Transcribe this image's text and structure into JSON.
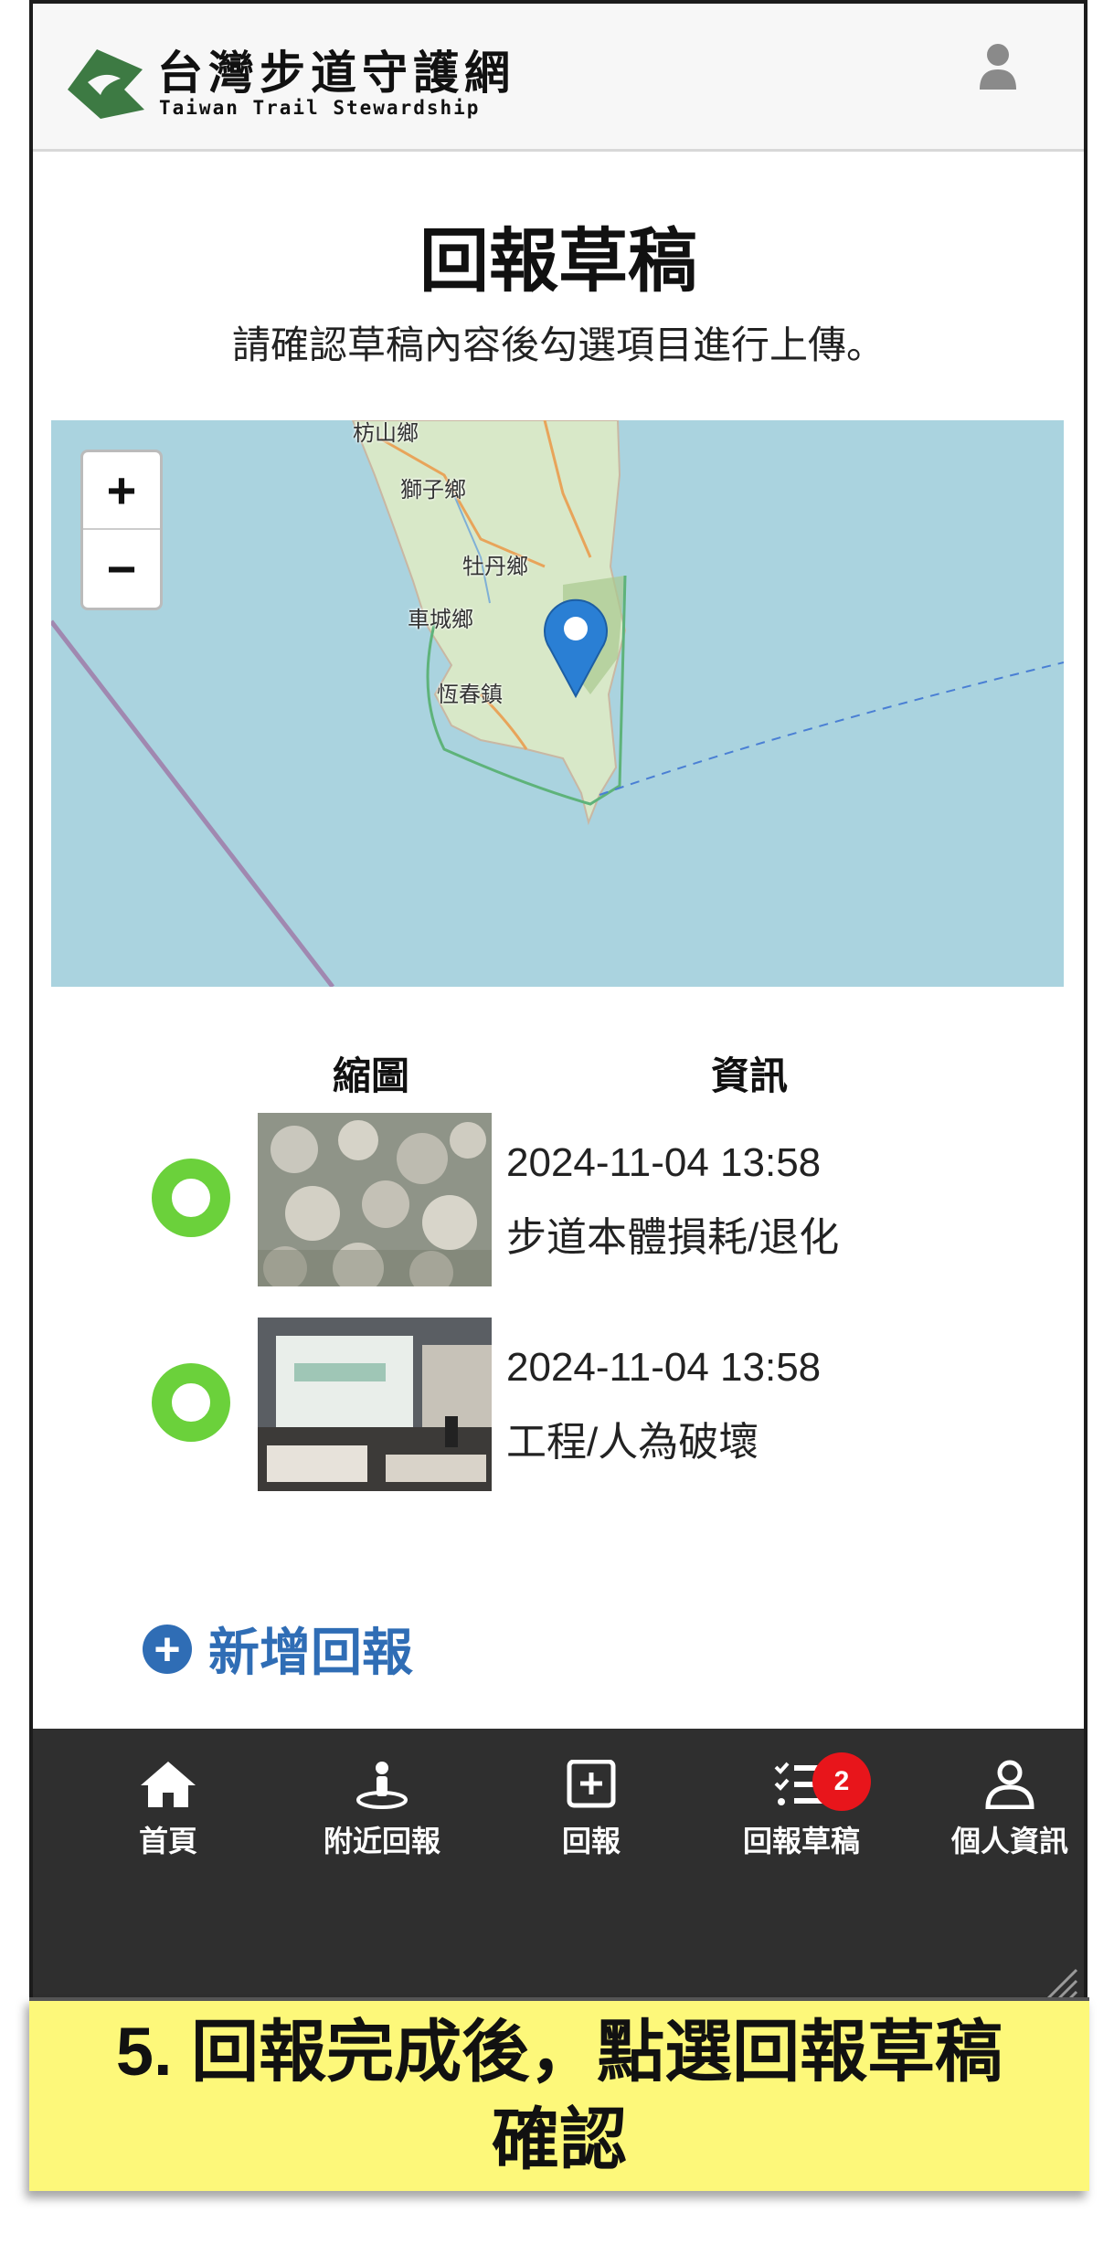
{
  "header": {
    "brand_cn": "台灣步道守護網",
    "brand_en": "Taiwan Trail Stewardship",
    "logo_icon": "trail-leaf-logo",
    "user_icon": "user-icon"
  },
  "page": {
    "title": "回報草稿",
    "subtitle": "請確認草稿內容後勾選項目進行上傳。"
  },
  "map": {
    "zoom_in": "+",
    "zoom_out": "−",
    "labels": [
      "枋山鄉",
      "獅子鄉",
      "牡丹鄉",
      "車城鄉",
      "恆春鎮"
    ],
    "colors": {
      "sea": "#aad3df",
      "land": "#d8e8c8",
      "marker": "#2a7fd4"
    }
  },
  "drafts": {
    "col_thumbnail": "縮圖",
    "col_info": "資訊",
    "items": [
      {
        "date": "2024-11-04 13:58",
        "type": "步道本體損耗/退化"
      },
      {
        "date": "2024-11-04 13:58",
        "type": "工程/人為破壞"
      }
    ]
  },
  "add_report": {
    "label": "新增回報",
    "icon": "plus-circle-icon"
  },
  "nav": {
    "items": [
      {
        "label": "首頁",
        "icon": "home-icon"
      },
      {
        "label": "附近回報",
        "icon": "nearby-person-icon"
      },
      {
        "label": "回報",
        "icon": "plus-square-icon"
      },
      {
        "label": "回報草稿",
        "icon": "checklist-icon",
        "badge": "2"
      },
      {
        "label": "個人資訊",
        "icon": "profile-icon"
      }
    ]
  },
  "caption": {
    "line1": "5. 回報完成後，點選回報草稿",
    "line2": "確認"
  },
  "colors": {
    "accent": "#2f6db5",
    "radio": "#6bd13b",
    "badge": "#e8151b",
    "caption_bg": "#fdf87a",
    "nav_bg": "#2f2f2f"
  }
}
